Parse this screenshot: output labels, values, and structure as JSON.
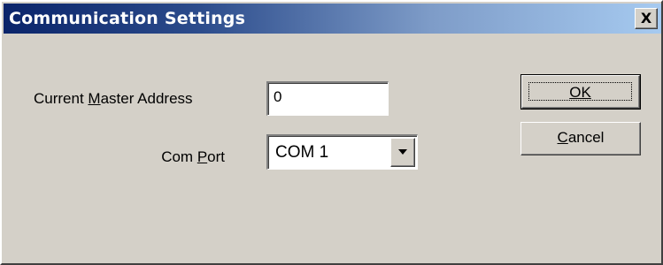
{
  "window": {
    "title": "Communication Settings",
    "close_glyph": "X"
  },
  "form": {
    "master_address": {
      "label_pre": "Current ",
      "label_mnemonic": "M",
      "label_post": "aster Address",
      "value": "0"
    },
    "com_port": {
      "label_pre": "Com ",
      "label_mnemonic": "P",
      "label_post": "ort",
      "value": "COM 1"
    }
  },
  "buttons": {
    "ok_label": "OK",
    "cancel_mnemonic": "C",
    "cancel_post": "ancel"
  },
  "colors": {
    "dialog_face": "#d4d0c8",
    "title_start": "#0a246a",
    "title_end": "#a6caf0"
  }
}
